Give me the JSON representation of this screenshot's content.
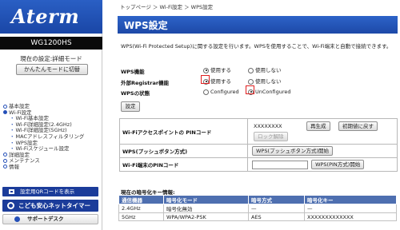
{
  "sidebar": {
    "logo": "Aterm",
    "model": "WG1200HS",
    "mode_label": "現在の設定:詳細モード",
    "mode_button": "かんたんモードに切替",
    "nav": [
      {
        "label": "基本設定",
        "level": 0
      },
      {
        "label": "Wi-Fi設定",
        "level": 0
      },
      {
        "label": "Wi-Fi基本設定",
        "level": 1
      },
      {
        "label": "Wi-Fi詳細設定(2.4GHz)",
        "level": 1
      },
      {
        "label": "Wi-Fi詳細設定(5GHz)",
        "level": 1
      },
      {
        "label": "MACアドレスフィルタリング",
        "level": 1
      },
      {
        "label": "WPS設定",
        "level": 1
      },
      {
        "label": "Wi-Fiスケジュール設定",
        "level": 1
      },
      {
        "label": "詳細設定",
        "level": 0
      },
      {
        "label": "メンテナンス",
        "level": 0
      },
      {
        "label": "情報",
        "level": 0
      }
    ],
    "qr_button": "設定用QRコードを表示",
    "kids_button": "こども安心ネットタイマー",
    "support_button": "サポートデスク"
  },
  "breadcrumb": "トップページ ＞ Wi-Fi設定 ＞ WPS設定",
  "title": "WPS設定",
  "description": "WPS(Wi-Fi Protected Setup)に関する設定を行います。WPSを使用することで、Wi-Fi端末と自動で接続できます。",
  "options": {
    "wps_function": {
      "label": "WPS機能",
      "choices": [
        "使用する",
        "使用しない"
      ],
      "selected": 0
    },
    "external_registrar": {
      "label": "外部Registrar機能",
      "choices": [
        "使用する",
        "使用しない"
      ],
      "selected": 0
    },
    "wps_state": {
      "label": "WPSの状態",
      "choices": [
        "Configured",
        "UnConfigured"
      ],
      "selected": 1
    }
  },
  "settings_button": "設定",
  "wps_table": {
    "ap_pin": {
      "label": "Wi-Fiアクセスポイントの PINコード",
      "pin": "XXXXXXXX",
      "regenerate": "再生成",
      "reset": "初期値に戻す",
      "lock_release": "ロック解除"
    },
    "push_button": {
      "label": "WPS(プッシュボタン方式)",
      "button": "WPS(プッシュボタン方式)開始"
    },
    "client_pin": {
      "label": "Wi-Fi端末のPINコード",
      "button": "WPS(PIN方式)開始"
    }
  },
  "encryption": {
    "heading": "現在の暗号化キー情報:",
    "headers": [
      "通信機器",
      "暗号化モード",
      "暗号方式",
      "暗号化キー"
    ],
    "rows": [
      [
        "2.4GHz",
        "暗号化無効",
        "—",
        "—"
      ],
      [
        "5GHz",
        "WPA/WPA2-PSK",
        "AES",
        "XXXXXXXXXXXXX"
      ]
    ]
  },
  "colors": {
    "accent": "#1d49a8",
    "highlight": "#e02020",
    "table_header": "#4e6fb0"
  }
}
